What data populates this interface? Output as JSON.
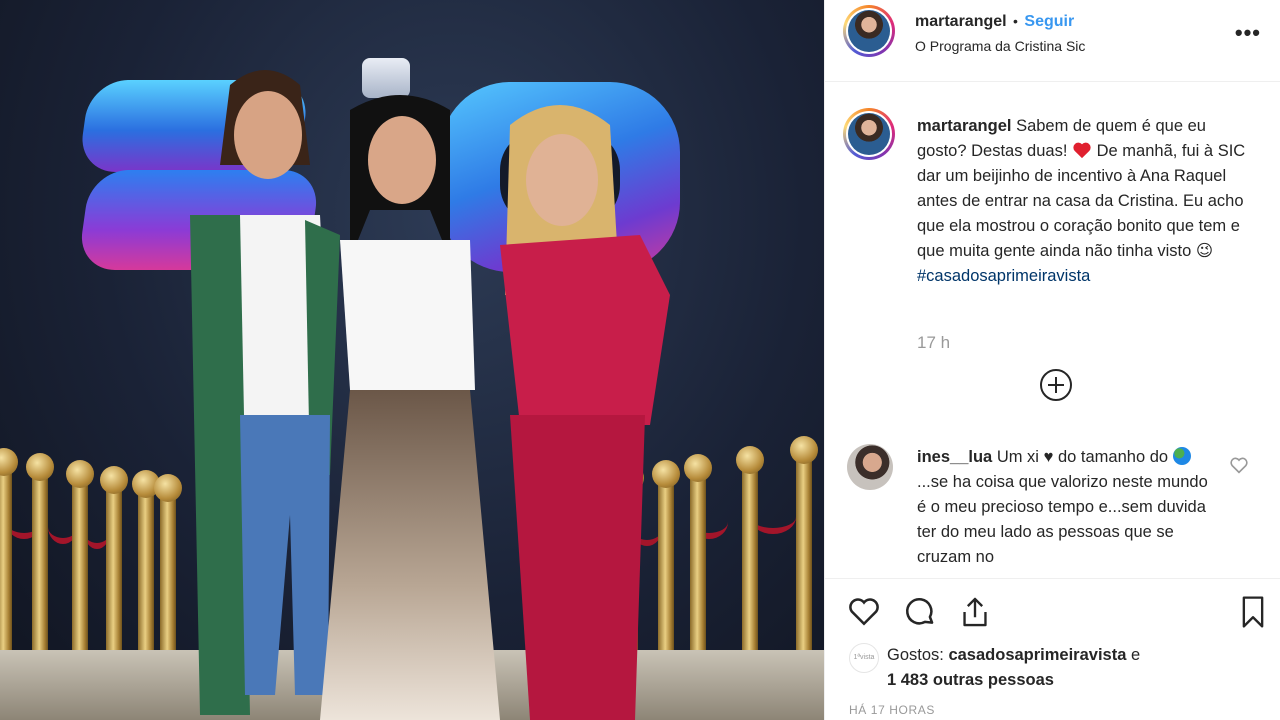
{
  "post": {
    "username": "martarangel",
    "separator": "•",
    "follow_label": "Seguir",
    "location": "O Programa da Cristina Sic",
    "more_label": "•••"
  },
  "caption": {
    "username": "martarangel",
    "text_part1": "Sabem de quem é que eu gosto? Destas duas!",
    "text_part2": "De manhã, fui à SIC dar um beijinho de incentivo à Ana Raquel antes de entrar na casa da Cristina. Eu acho que ela mostrou o coração bonito que tem e que muita gente ainda não tinha visto",
    "emoji_wink": "😉",
    "hashtag": "#casadosaprimeiravista",
    "time": "17 h"
  },
  "comment": {
    "username": "ines__lua",
    "text_part1": "Um xi",
    "heart": "♥",
    "text_part2": "do tamanho do",
    "text_part3": "...se ha coisa que valorizo neste mundo é o meu precioso tempo e...sem duvida ter do meu lado as pessoas que se cruzam no"
  },
  "likes": {
    "prefix": "Gostos:",
    "first_liker": "casadosaprimeiravista",
    "connector": "e",
    "others": "1 483 outras pessoas",
    "avatar_text": "1ªvista"
  },
  "timestamp": "HÁ 17 HORAS",
  "icons": [
    "heart-outline-icon",
    "comment-icon",
    "share-icon",
    "bookmark-icon",
    "plus-circle-icon",
    "more-icon"
  ],
  "colors": {
    "link": "#3897f0",
    "hashtag": "#003569",
    "muted": "#999999",
    "heart_red": "#ed4956"
  }
}
